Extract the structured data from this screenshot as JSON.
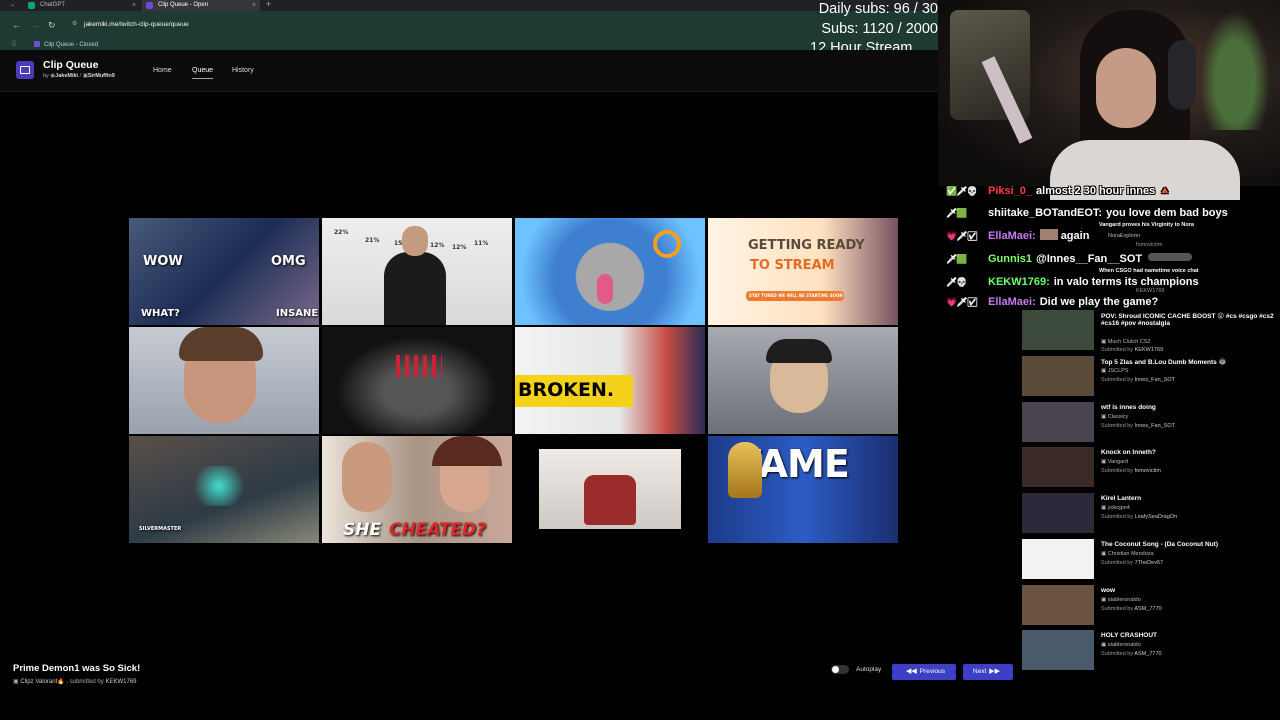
{
  "browser": {
    "tabs": [
      {
        "label": "ChatGPT",
        "color": "#10a37f"
      },
      {
        "label": "Clip Queue - Open",
        "color": "#6f4bd8"
      }
    ],
    "new_tab_glyph": "+",
    "close_glyph": "×",
    "url_host": "jakemiki.me",
    "url_path": "/twitch-clip-queue/queue",
    "bookmark": "Clip Queue - Closed"
  },
  "overlay": {
    "daily_subs": "Daily subs: 96 / 30",
    "subs": "Subs: 1120 / 2000",
    "stream": "12 Hour Stream"
  },
  "app": {
    "title": "Clip Queue",
    "by_prefix": "by",
    "author1": "JakeMiki",
    "separator": "/",
    "author2": "SirMuffin9",
    "nav": [
      {
        "label": "Home",
        "active": false
      },
      {
        "label": "Queue",
        "active": true
      },
      {
        "label": "History",
        "active": false
      }
    ]
  },
  "grid": {
    "thumbnails": [
      {
        "captions": [
          "WOW",
          "OMG",
          "WHAT?",
          "INSANE"
        ]
      },
      {
        "captions": [
          "22%",
          "21%",
          "15%",
          "12%",
          "12%",
          "11%"
        ]
      },
      {
        "captions": []
      },
      {
        "captions": [
          "GETTING READY",
          "TO STREAM",
          "STAY TUNED WE WILL BE STARTING SOON"
        ]
      },
      {
        "captions": []
      },
      {
        "captions": []
      },
      {
        "captions": [
          "BROKEN."
        ]
      },
      {
        "captions": []
      },
      {
        "captions": [
          "SILVERMASTER"
        ]
      },
      {
        "captions": [
          "SHE",
          "CHEATED?"
        ]
      },
      {
        "captions": []
      },
      {
        "captions": [
          "FAME"
        ]
      }
    ]
  },
  "current_clip": {
    "title": "Prime Demon1 was So Sick!",
    "channel": "Clipz Valorant",
    "submitted_prefix": ", submitted by",
    "submitter": "KEKW1769"
  },
  "controls": {
    "autoplay_label": "Autoplay",
    "autoplay_on": false,
    "previous_label": "Previous",
    "next_label": "Next"
  },
  "queue_partial": [
    {
      "text": "Vangard proves his Virginity to Nora"
    },
    {
      "text": "NoraExplorer"
    },
    {
      "text": "fomovictim"
    },
    {
      "text": "When CSGO had nametime voice chat"
    },
    {
      "text": "KEKW1769"
    }
  ],
  "queue": [
    {
      "title": "POV: Shroud ICONIC CACHE BOOST 😮 #cs #csgo #cs2",
      "title2": "#cs16 #pov #nostalgia",
      "channel": "Much Clutch CS2",
      "submitter": "KEKW1769",
      "thumb": "#3b4a3a"
    },
    {
      "title": "Top 5 Zlas and B.Lou Dumb Moments 😂",
      "channel": "JSCLPS",
      "submitter": "Innes_Fan_SOT",
      "thumb": "#5b4a3a"
    },
    {
      "title": "wtf is innes doing",
      "channel": "Classicy",
      "submitter": "Innes_Fan_SOT",
      "thumb": "#4a4450"
    },
    {
      "title": "Knock on Inneth?",
      "channel": "Vangard",
      "submitter": "fomovictim",
      "thumb": "#3a2a28"
    },
    {
      "title": "Kirel Lantern",
      "channel": "yokojpn4",
      "submitter": "LeafySeaDragOn",
      "thumb": "#2a2a3a"
    },
    {
      "title": "The Coconut Song - (Da Coconut Nut)",
      "channel": "Christian Mendoza",
      "submitter": "7TheDev67",
      "thumb": "#f2f2f2"
    },
    {
      "title": "wow",
      "channel": "stableronaldo",
      "submitter": "ASM_7770",
      "thumb": "#6a5240"
    },
    {
      "title": "HOLY CRASHOUT",
      "channel": "stableronaldo",
      "submitter": "ASM_7770",
      "thumb": "#4a5a6a"
    }
  ],
  "queue_labels": {
    "submitted_by": "Submitted by"
  },
  "chat": [
    {
      "badges": "✅🗡💀",
      "user": "Piksi_0_",
      "color": "#ff3c3c",
      "text": "almost 2 30 hour innes 🔺"
    },
    {
      "badges": "🗡🟩",
      "user": "shiitake_BOTandEOT:",
      "color": "#ffffff",
      "text": "you love dem bad boys"
    },
    {
      "badges": "💗🗡☑",
      "user": "EllaMaei:",
      "color": "#c87af0",
      "text": "again"
    },
    {
      "badges": "🗡🟩",
      "user": "Gunnis1",
      "color": "#7cff6b",
      "text": "@Innes__Fan__SOT"
    },
    {
      "badges": "🗡💀",
      "user": "KEKW1769:",
      "color": "#6bff6b",
      "text": "in valo terms its champions"
    },
    {
      "badges": "💗🗡☑",
      "user": "EllaMaei:",
      "color": "#c87af0",
      "text": "Did we play the game?"
    }
  ]
}
